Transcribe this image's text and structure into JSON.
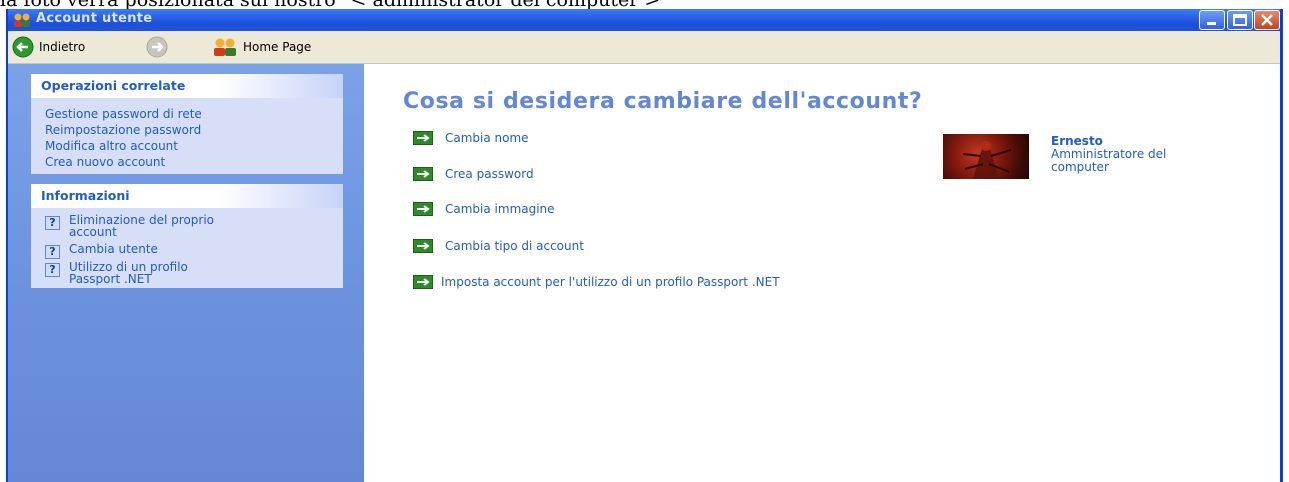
{
  "caption": "la foto verrà posizionata sul nostro \"< administrator del computer >\"",
  "window": {
    "title": "Account utente"
  },
  "toolbar": {
    "back_label": "Indietro",
    "home_label": "Home Page"
  },
  "sidebar": {
    "related": {
      "title": "Operazioni correlate",
      "links": [
        "Gestione password di rete",
        "Reimpostazione password",
        "Modifica altro account",
        "Crea nuovo account"
      ]
    },
    "info": {
      "title": "Informazioni",
      "items": [
        {
          "line1": "Eliminazione del proprio",
          "line2": "account"
        },
        {
          "line1": "Cambia utente",
          "line2": ""
        },
        {
          "line1": "Utilizzo di un profilo",
          "line2": "Passport .NET"
        }
      ]
    }
  },
  "main": {
    "title": "Cosa si desidera cambiare dell'account?",
    "actions": [
      "Cambia nome",
      "Crea password",
      "Cambia immagine",
      "Cambia tipo di account",
      "Imposta account per l'utilizzo di un profilo Passport .NET"
    ]
  },
  "user": {
    "name": "Ernesto",
    "role": "Amministratore del computer"
  }
}
